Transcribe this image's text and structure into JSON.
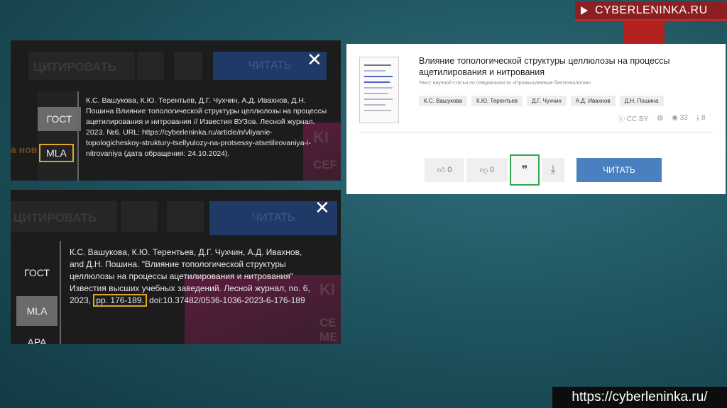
{
  "brand": {
    "label": "CYBERLENINKA.RU"
  },
  "footer": {
    "url": "https://cyberleninka.ru/"
  },
  "panel1": {
    "ghost_votes": "ЦИТИРОВАТЬ",
    "ghost_read": "ЧИТАТЬ",
    "close": "✕",
    "tab_gost": "ГОСТ",
    "tab_mla": "MLA",
    "citation": "К.С. Вашукова, К.Ю. Терентьев, Д.Г. Чухчин, А.Д. Ивахнов, Д.Н. Пошина Влияние топологической структуры целлюлозы на процессы ацетилирования и нитрования // Известия ВУЗов. Лесной журнал. 2023. №6. URL: https://cyberleninka.ru/article/n/vliyanie-topologicheskoy-struktury-tsellyulozy-na-protsessy-atsetilirovaniya-i-nitrovaniya (дата обращения: 24.10.2024)."
  },
  "panel2": {
    "ghost_votes": "ЦИТИРОВАТЬ",
    "ghost_read": "ЧИТАТЬ",
    "close": "✕",
    "tab_gost": "ГОСТ",
    "tab_mla": "MLA",
    "tab_apa": "APA",
    "citation_a": "К.С. Вашукова, К.Ю. Терентьев, Д.Г. Чухчин, А.Д. Ивахнов, and Д.Н. Пошина. \"Влияние топологической структуры целлюлозы на процессы ацетилирования и нитрования\" Известия высших учебных заведений. Лесной журнал, no. 6, 2023,",
    "citation_pp": "pp. 176-189.",
    "citation_b": "doi:10.37482/0536-1036-2023-6-176-189"
  },
  "card": {
    "title": "Влияние топологической структуры целлюлозы на процессы ацетилирования и нитрования",
    "subtitle": "Текст научной статьи по специальности «Промышленные биотехнологии»",
    "authors": [
      "К.С. Вашукова",
      "К.Ю. Терентьев",
      "Д.Г. Чухчин",
      "А.Д. Ивахнов",
      "Д.Н. Пошина"
    ],
    "license": "CC BY",
    "views": "33",
    "downloads": "8",
    "like_count": "0",
    "dislike_count": "0",
    "quote_icon": "❞",
    "download_icon": "⤓",
    "read_label": "ЧИТАТЬ"
  }
}
